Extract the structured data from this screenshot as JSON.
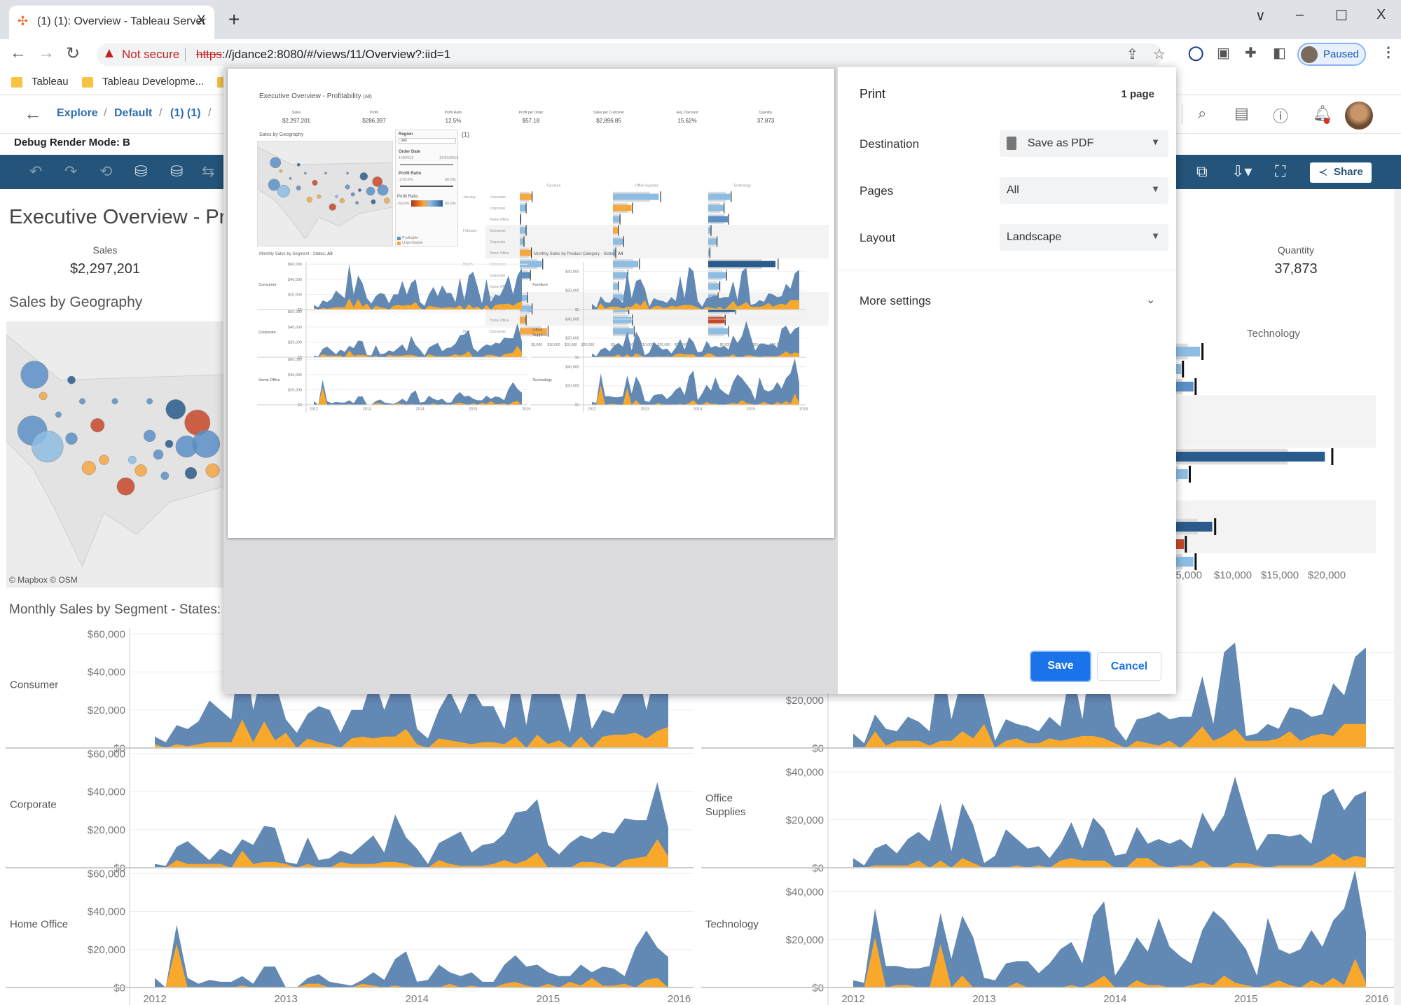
{
  "browser": {
    "tab_title": "(1) (1): Overview - Tableau Server",
    "tab_close": "X",
    "new_tab": "+",
    "window_controls": {
      "tab_search": "∨",
      "minimize": "–",
      "maximize": "☐",
      "close": "X"
    },
    "not_secure": "Not secure",
    "url_scheme": "https",
    "url_rest": "://jdance2:8080/#/views/11/Overview?:iid=1",
    "profile_status": "Paused",
    "bookmarks": [
      "Tableau",
      "Tableau Developme..."
    ]
  },
  "tableau_header": {
    "breadcrumb": [
      "Explore",
      "Default",
      "(1) (1)"
    ],
    "separator": "/",
    "debug_mode": "Debug Render Mode: B",
    "share_label": "Share"
  },
  "dashboard": {
    "title": "Executive Overview - Profitability",
    "title_suffix": "(All)",
    "kpis": [
      {
        "label": "Sales",
        "value": "$2,297,201"
      },
      {
        "label": "Profit",
        "value": "$286,397"
      },
      {
        "label": "Profit Ratio",
        "value": "12.5%"
      },
      {
        "label": "Profit per Order",
        "value": "$57.18"
      },
      {
        "label": "Sales per Customer",
        "value": "$2,896.85"
      },
      {
        "label": "Avg. Discount",
        "value": "15.62%"
      },
      {
        "label": "Quantity",
        "value": "37,873"
      }
    ],
    "geo_title": "Sales by Geography",
    "map_credit": "© Mapbox  © OSM",
    "segment_title": "Monthly Sales by Segment - States: ",
    "category_title": "Monthly Sales by Product Category - States: ",
    "states_value": "All",
    "filters": {
      "region_label": "Region",
      "region_value": "(All)",
      "order_date_label": "Order Date",
      "date_from": "1/4/2012",
      "date_to": "12/31/2015",
      "profit_ratio_label": "Profit Ratio",
      "pr_from": "-270.0%",
      "pr_to": "60.0%",
      "legend_label": "Profit Ratio",
      "legend_from": "-60.0%",
      "legend_to": "60.0%",
      "profitable": "Profitable",
      "unprofitable": "Unprofitable"
    },
    "bar_view_title": "(1)",
    "bar_categories": [
      "Furniture",
      "Office Supplies",
      "Technology"
    ],
    "bar_rows": [
      {
        "month": "January",
        "segment": "Consumer"
      },
      {
        "month": "",
        "segment": "Corporate"
      },
      {
        "month": "",
        "segment": "Home Office"
      },
      {
        "month": "February",
        "segment": "Consumer"
      },
      {
        "month": "",
        "segment": "Corporate"
      },
      {
        "month": "",
        "segment": "Home Office"
      },
      {
        "month": "March",
        "segment": "Consumer"
      },
      {
        "month": "",
        "segment": "Corporate"
      },
      {
        "month": "",
        "segment": "Home Office"
      },
      {
        "month": "April",
        "segment": "Consumer"
      },
      {
        "month": "",
        "segment": "Corporate"
      },
      {
        "month": "",
        "segment": "Home Office"
      },
      {
        "month": "May",
        "segment": "Consumer"
      }
    ],
    "bar_axis_ticks": [
      "$0",
      "$5,000",
      "$10,000",
      "$15,000",
      "$20,000"
    ],
    "bar_values": {
      "Furniture": [
        [
          3500,
          "orange"
        ],
        [
          1800,
          "light"
        ],
        [
          300,
          "light"
        ],
        [
          1800,
          "light"
        ],
        [
          1200,
          "light"
        ],
        [
          3300,
          "orange"
        ],
        [
          6500,
          "light"
        ],
        [
          3000,
          "mid"
        ],
        [
          500,
          "light"
        ],
        [
          2200,
          "light"
        ],
        [
          3500,
          "light"
        ],
        [
          1800,
          "orange"
        ],
        [
          8000,
          "orange"
        ]
      ],
      "Office Supplies": [
        [
          13500,
          "light"
        ],
        [
          5500,
          "orange"
        ],
        [
          2000,
          "light"
        ],
        [
          1500,
          "orange"
        ],
        [
          3000,
          "light"
        ],
        [
          800,
          "light"
        ],
        [
          7500,
          "light"
        ],
        [
          4200,
          "light"
        ],
        [
          1500,
          "light"
        ],
        [
          3300,
          "light"
        ],
        [
          4500,
          "light"
        ],
        [
          5500,
          "light"
        ],
        [
          6000,
          "light"
        ]
      ],
      "Technology": [
        [
          6500,
          "light"
        ],
        [
          4500,
          "light"
        ],
        [
          5800,
          "mid"
        ],
        [
          800,
          "light"
        ],
        [
          2500,
          "light"
        ],
        [
          500,
          "light"
        ],
        [
          19800,
          "dark"
        ],
        [
          5200,
          "light"
        ],
        [
          3300,
          "light"
        ],
        [
          2800,
          "light"
        ],
        [
          7800,
          "dark"
        ],
        [
          4800,
          "red"
        ],
        [
          5800,
          "light"
        ]
      ]
    },
    "segments": [
      "Consumer",
      "Corporate",
      "Home Office"
    ],
    "categories": [
      "Furniture",
      "Office Supplies",
      "Technology"
    ],
    "left_ticks": [
      "$0",
      "$20,000",
      "$40,000",
      "$60,000"
    ],
    "right_ticks": [
      "$0",
      "$20,000",
      "$40,000"
    ],
    "years": [
      "2012",
      "2013",
      "2014",
      "2015",
      "2016"
    ],
    "colors": {
      "sales_area": "#6288b4",
      "profit_area": "#f8a92b",
      "toolbar": "#245479",
      "accent": "#1a73e8",
      "light": "#8dbde3",
      "mid": "#5b8fc5",
      "dark": "#295b8c",
      "orange": "#f5a742",
      "red": "#c8472a"
    }
  },
  "chart_data": {
    "type": "area",
    "x": "monthly, Jan 2012 – Dec 2015",
    "series_segments": {
      "Consumer": {
        "sales": [
          6,
          3,
          12,
          10,
          14,
          25,
          20,
          15,
          60,
          20,
          45,
          35,
          15,
          8,
          18,
          22,
          20,
          8,
          20,
          20,
          38,
          20,
          35,
          40,
          10,
          5,
          20,
          30,
          18,
          32,
          22,
          22,
          10,
          42,
          12,
          45,
          50,
          30,
          8,
          40,
          10,
          20,
          18,
          30,
          45,
          20,
          45,
          55
        ],
        "profit": [
          2,
          0,
          2,
          1,
          2,
          3,
          3,
          3,
          15,
          3,
          14,
          4,
          8,
          0,
          5,
          3,
          2,
          0,
          5,
          6,
          5,
          6,
          6,
          10,
          2,
          0,
          5,
          4,
          3,
          2,
          3,
          3,
          2,
          6,
          0,
          7,
          2,
          4,
          0,
          6,
          0,
          6,
          7,
          7,
          8,
          5,
          9,
          11
        ]
      },
      "Corporate": {
        "sales": [
          2,
          1,
          11,
          14,
          9,
          4,
          10,
          7,
          15,
          12,
          22,
          21,
          3,
          2,
          16,
          4,
          5,
          9,
          7,
          12,
          17,
          8,
          28,
          16,
          10,
          2,
          13,
          16,
          19,
          8,
          12,
          13,
          18,
          29,
          30,
          36,
          12,
          7,
          13,
          17,
          15,
          19,
          18,
          26,
          25,
          25,
          45,
          21
        ],
        "profit": [
          0,
          0,
          4,
          2,
          2,
          2,
          2,
          0,
          9,
          2,
          3,
          3,
          2,
          0,
          2,
          0,
          0,
          3,
          2,
          2,
          2,
          3,
          3,
          2,
          0,
          0,
          4,
          2,
          1,
          1,
          1,
          2,
          4,
          2,
          4,
          8,
          0,
          0,
          0,
          3,
          3,
          2,
          0,
          4,
          5,
          6,
          15,
          6
        ]
      },
      "Home Office": {
        "sales": [
          5,
          0,
          33,
          5,
          2,
          4,
          3,
          3,
          6,
          2,
          11,
          11,
          0,
          0,
          5,
          7,
          3,
          2,
          1,
          4,
          8,
          4,
          15,
          19,
          3,
          4,
          12,
          8,
          6,
          8,
          3,
          3,
          12,
          17,
          11,
          12,
          8,
          6,
          6,
          12,
          8,
          11,
          10,
          6,
          21,
          30,
          21,
          16
        ],
        "profit": [
          0,
          0,
          23,
          0,
          0,
          0,
          0,
          0,
          1,
          0,
          0,
          0,
          0,
          0,
          2,
          2,
          0,
          0,
          0,
          2,
          1,
          0,
          1,
          0,
          0,
          0,
          0,
          2,
          0,
          1,
          0,
          0,
          2,
          3,
          1,
          0,
          2,
          0,
          3,
          1,
          5,
          1,
          1,
          2,
          0,
          4,
          5,
          0
        ]
      }
    },
    "series_categories": {
      "Furniture": {
        "sales": [
          6,
          2,
          14,
          8,
          7,
          13,
          11,
          7,
          40,
          12,
          30,
          32,
          22,
          3,
          12,
          10,
          9,
          7,
          13,
          9,
          35,
          12,
          45,
          40,
          9,
          3,
          12,
          13,
          15,
          12,
          13,
          13,
          30,
          10,
          40,
          44,
          5,
          6,
          10,
          8,
          17,
          16,
          13,
          14,
          27,
          22,
          38,
          42
        ],
        "profit": [
          0,
          0,
          7,
          1,
          3,
          3,
          3,
          1,
          3,
          3,
          7,
          4,
          10,
          0,
          3,
          4,
          2,
          2,
          4,
          3,
          4,
          5,
          5,
          4,
          2,
          0,
          3,
          2,
          1,
          3,
          0,
          4,
          9,
          3,
          5,
          8,
          3,
          3,
          3,
          4,
          7,
          3,
          5,
          6,
          5,
          10,
          10,
          10
        ]
      },
      "Office Supplies": {
        "sales": [
          4,
          1,
          8,
          10,
          6,
          12,
          15,
          11,
          27,
          7,
          27,
          18,
          2,
          5,
          16,
          12,
          8,
          9,
          4,
          10,
          19,
          8,
          21,
          16,
          5,
          6,
          17,
          10,
          12,
          10,
          12,
          8,
          23,
          15,
          22,
          38,
          22,
          7,
          14,
          14,
          13,
          14,
          10,
          30,
          33,
          24,
          30,
          32
        ],
        "profit": [
          0,
          0,
          1,
          1,
          1,
          1,
          3,
          0,
          3,
          0,
          4,
          2,
          0,
          0,
          0,
          1,
          0,
          1,
          0,
          3,
          4,
          3,
          3,
          3,
          0,
          0,
          4,
          4,
          1,
          0,
          1,
          1,
          3,
          0,
          0,
          2,
          2,
          1,
          0,
          1,
          1,
          1,
          1,
          3,
          6,
          3,
          5,
          4
        ]
      },
      "Technology": {
        "sales": [
          3,
          2,
          33,
          9,
          9,
          8,
          8,
          9,
          31,
          12,
          30,
          21,
          4,
          3,
          10,
          11,
          11,
          6,
          10,
          16,
          19,
          10,
          30,
          36,
          5,
          12,
          21,
          15,
          29,
          17,
          13,
          10,
          24,
          32,
          28,
          22,
          16,
          5,
          29,
          16,
          14,
          16,
          24,
          17,
          28,
          33,
          49,
          23
        ],
        "profit": [
          0,
          0,
          21,
          0,
          1,
          1,
          0,
          0,
          18,
          0,
          5,
          0,
          0,
          0,
          0,
          2,
          0,
          0,
          0,
          0,
          1,
          0,
          2,
          5,
          0,
          0,
          3,
          1,
          1,
          0,
          0,
          1,
          2,
          1,
          5,
          2,
          1,
          0,
          1,
          3,
          1,
          0,
          3,
          1,
          4,
          1,
          12,
          2
        ]
      }
    },
    "units": "thousands of $",
    "left_ylim": [
      0,
      63
    ],
    "right_ylim": [
      0,
      50
    ]
  },
  "print_dialog": {
    "title": "Print",
    "page_count": "1 page",
    "destination_label": "Destination",
    "destination_value": "Save as PDF",
    "pages_label": "Pages",
    "pages_value": "All",
    "layout_label": "Layout",
    "layout_value": "Landscape",
    "more_settings": "More settings",
    "save": "Save",
    "cancel": "Cancel"
  }
}
